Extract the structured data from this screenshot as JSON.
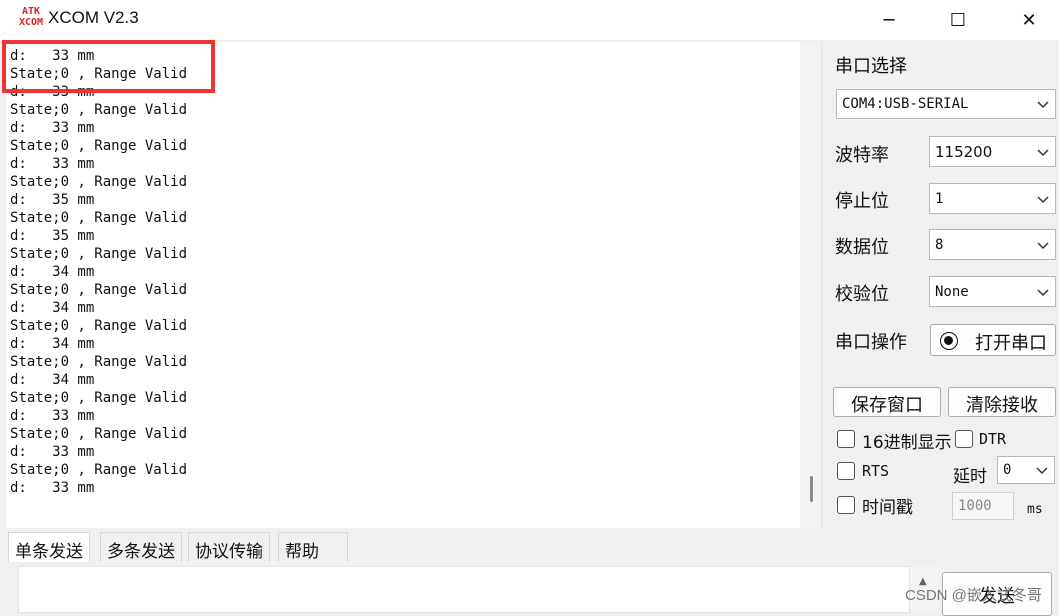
{
  "window": {
    "logo_top": "ATK",
    "logo_bottom": "XCOM",
    "title": "XCOM V2.3",
    "minimize": "─",
    "maximize": "☐",
    "close": "✕"
  },
  "receive": {
    "lines": [
      "d:   33 mm",
      "State;0 , Range Valid",
      "d:   33 mm",
      "State;0 , Range Valid",
      "d:   33 mm",
      "State;0 , Range Valid",
      "d:   33 mm",
      "State;0 , Range Valid",
      "d:   35 mm",
      "State;0 , Range Valid",
      "d:   35 mm",
      "State;0 , Range Valid",
      "d:   34 mm",
      "State;0 , Range Valid",
      "d:   34 mm",
      "State;0 , Range Valid",
      "d:   34 mm",
      "State;0 , Range Valid",
      "d:   34 mm",
      "State;0 , Range Valid",
      "d:   33 mm",
      "State;0 , Range Valid",
      "d:   33 mm",
      "State;0 , Range Valid",
      "d:   33 mm"
    ],
    "highlight_color": "#ee3333"
  },
  "settings": {
    "port_section_label": "串口选择",
    "port_value": "COM4:USB-SERIAL",
    "baud_label": "波特率",
    "baud_value": "115200",
    "stop_label": "停止位",
    "stop_value": "1",
    "data_label": "数据位",
    "data_value": "8",
    "parity_label": "校验位",
    "parity_value": "None",
    "operate_label": "串口操作",
    "open_button": "打开串口",
    "save_button": "保存窗口",
    "clear_button": "清除接收",
    "hex_display": "16进制显示",
    "dtr": "DTR",
    "rts": "RTS",
    "delay_label": "延时",
    "delay_value": "0",
    "timestamp": "时间戳",
    "timestamp_value": "1000",
    "timestamp_unit": "ms"
  },
  "tabs": [
    "单条发送",
    "多条发送",
    "协议传输",
    "帮助"
  ],
  "send": {
    "button": "发送"
  },
  "watermark": "CSDN @嵌入式冬哥",
  "icons": {
    "app_logo": "atk-xcom-logo-icon",
    "chevron": "chevron-down-icon",
    "radio": "radio-icon"
  }
}
